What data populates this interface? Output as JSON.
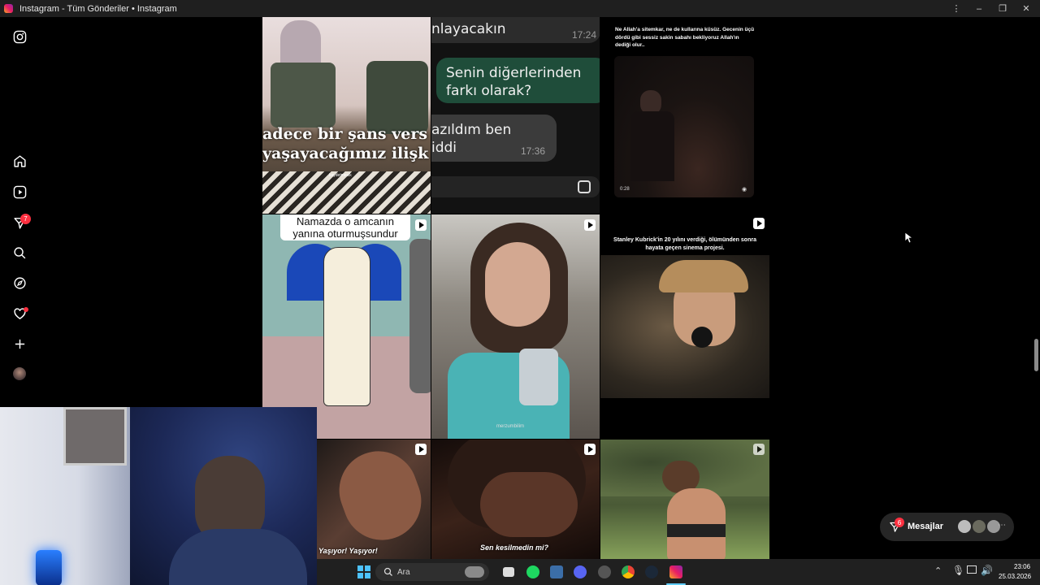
{
  "window": {
    "title": "Instagram - Tüm Gönderiler • Instagram",
    "controls": [
      "⋮",
      "–",
      "❐",
      "✕"
    ]
  },
  "sidebar": {
    "items": [
      {
        "name": "instagram-logo-icon"
      },
      {
        "name": "home-icon"
      },
      {
        "name": "reels-icon"
      },
      {
        "name": "messages-icon",
        "badge": "7"
      },
      {
        "name": "search-icon"
      },
      {
        "name": "explore-icon"
      },
      {
        "name": "notifications-icon"
      },
      {
        "name": "create-icon"
      },
      {
        "name": "profile-avatar"
      }
    ]
  },
  "feed": {
    "tile1": {
      "caption_line1": "adece bir şans vers",
      "caption_line2": "yaşayacağımız ilişk",
      "watermark": "kaydetmesik"
    },
    "tile2": {
      "bubble_top": "nlayacakın",
      "time_top": "17:24",
      "bubble_green": "Senin diğerlerinden farkı olarak?",
      "bubble_grey_line1": "azıldım ben",
      "bubble_grey_line2": "iddi",
      "time_grey": "17:36"
    },
    "tile3": {
      "caption": "Ne Allah'a sitemkar, ne de kullarına küsüz. Gecenin üçü dördü gibi sessiz sakin sabahı bekliyoruz Allah'ın dediği olur..",
      "time": "0:28"
    },
    "tile4": {
      "caption": "Namazda o amcanın yanına oturmuşsundur"
    },
    "tile5": {
      "watermark": "merzumbilim"
    },
    "tile6": {
      "caption": "Stanley Kubrick'in 20 yılını verdiği, ölümünden sonra hayata geçen sinema projesi."
    },
    "tile7": {
      "caption": "Yaşıyor! Yaşıyor!"
    },
    "tile8": {
      "caption": "Sen kesilmedin mi?"
    }
  },
  "messages_pill": {
    "label": "Mesajlar",
    "badge": "6"
  },
  "taskbar": {
    "search_placeholder": "Ara",
    "time": "23:06",
    "date": "25.03.2026"
  },
  "colors": {
    "bg": "#000000",
    "badge": "#ff3040",
    "green_bubble": "#1f4d3a",
    "grey_bubble": "#3b3b3b"
  }
}
